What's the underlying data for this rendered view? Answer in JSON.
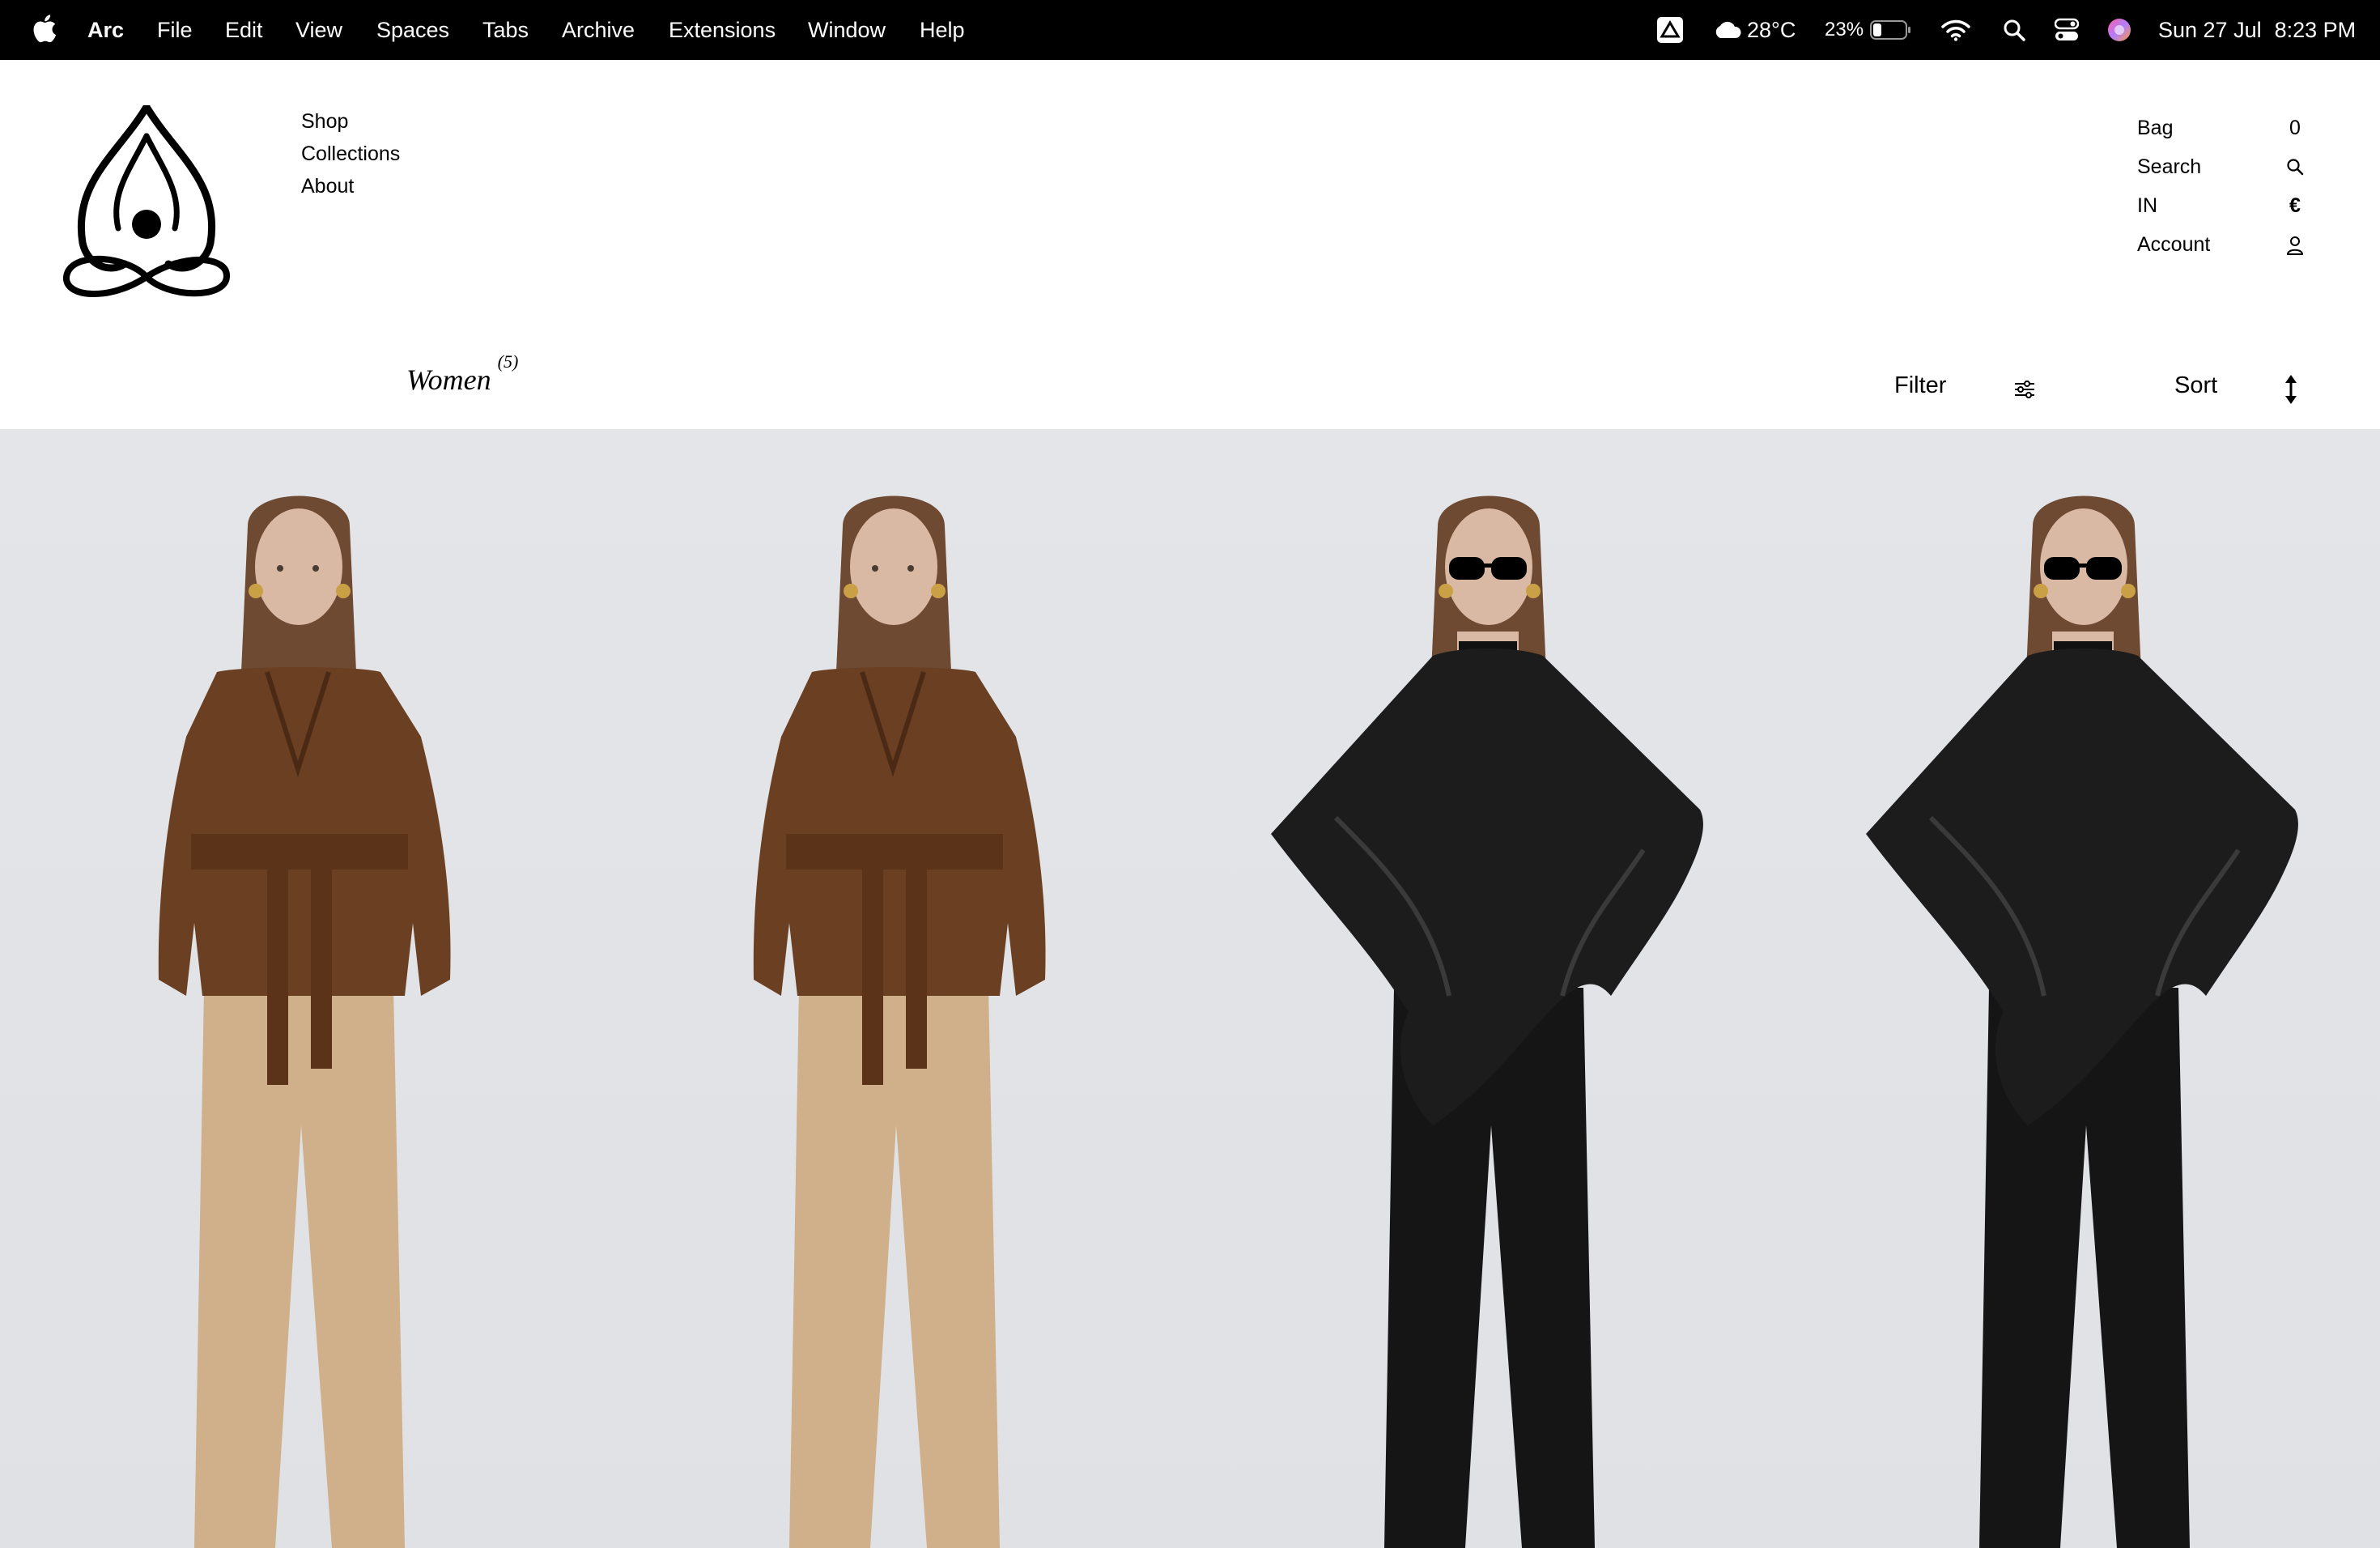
{
  "menubar": {
    "app_name": "Arc",
    "items": [
      "File",
      "Edit",
      "View",
      "Spaces",
      "Tabs",
      "Archive",
      "Extensions",
      "Window",
      "Help"
    ],
    "weather": "28°C",
    "battery": "23%",
    "date": "Sun 27 Jul",
    "time": "8:23 PM"
  },
  "nav": {
    "links": [
      "Shop",
      "Collections",
      "About"
    ]
  },
  "util": {
    "bag_label": "Bag",
    "bag_count": "0",
    "search_label": "Search",
    "region_label": "IN",
    "currency_symbol": "€",
    "account_label": "Account"
  },
  "category": {
    "title": "Women",
    "count": "(5)"
  },
  "toolbar": {
    "filter_label": "Filter",
    "sort_label": "Sort"
  },
  "products": [
    {
      "jacket_color": "#6b3f22",
      "pants_color": "#cfb08a",
      "style": "belted-jacket",
      "sunglasses": false
    },
    {
      "jacket_color": "#6b3f22",
      "pants_color": "#cfb08a",
      "style": "belted-jacket",
      "sunglasses": false
    },
    {
      "jacket_color": "#1c1c1c",
      "pants_color": "#151515",
      "style": "cape",
      "sunglasses": true
    },
    {
      "jacket_color": "#1c1c1c",
      "pants_color": "#151515",
      "style": "cape",
      "sunglasses": true
    }
  ],
  "colors": {
    "menubar_bg": "#000000",
    "page_bg": "#ffffff",
    "product_bg": "#e1e3e7"
  }
}
